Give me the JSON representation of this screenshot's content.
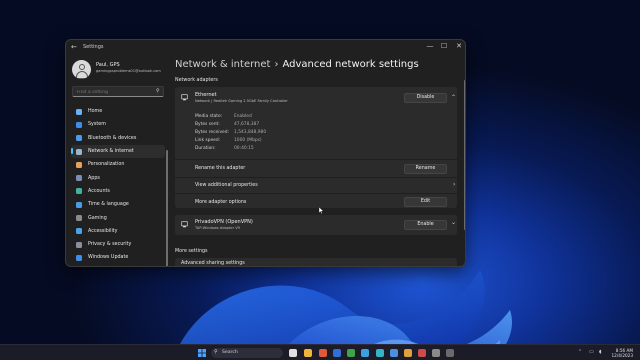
{
  "window": {
    "app_title": "Settings",
    "back_glyph": "←",
    "controls": {
      "minimize": "—",
      "maximize": "☐",
      "close": "✕"
    }
  },
  "user": {
    "name": "Paul, GPS",
    "email": "gamingpsproblems01@outlook.com"
  },
  "search": {
    "placeholder": "Find a setting",
    "icon": "search-icon"
  },
  "sidebar": {
    "items": [
      {
        "label": "Home",
        "color": "#6ab0f5"
      },
      {
        "label": "System",
        "color": "#3d8ee8"
      },
      {
        "label": "Bluetooth & devices",
        "color": "#4a9be8"
      },
      {
        "label": "Network & internet",
        "color": "#9fb3c8",
        "active": true
      },
      {
        "label": "Personalization",
        "color": "#e8a15b"
      },
      {
        "label": "Apps",
        "color": "#7c8db3"
      },
      {
        "label": "Accounts",
        "color": "#3fb3a0"
      },
      {
        "label": "Time & language",
        "color": "#4a9be8"
      },
      {
        "label": "Gaming",
        "color": "#8a8a8a"
      },
      {
        "label": "Accessibility",
        "color": "#4aa3e8"
      },
      {
        "label": "Privacy & security",
        "color": "#8a8fa0"
      },
      {
        "label": "Windows Update",
        "color": "#3d8ee8"
      }
    ]
  },
  "breadcrumb": {
    "parent": "Network & internet",
    "separator": "›",
    "current": "Advanced network settings"
  },
  "sections": {
    "adapters_label": "Network adapters",
    "more_label": "More settings"
  },
  "ethernet": {
    "name": "Ethernet",
    "description": "Network | Realtek Gaming 2.5GbE Family Controller",
    "button": "Disable",
    "details": [
      {
        "key": "Media state:",
        "value": "Enabled"
      },
      {
        "key": "Bytes sent:",
        "value": "47,678,387"
      },
      {
        "key": "Bytes received:",
        "value": "1,543,848,980"
      },
      {
        "key": "Link speed:",
        "value": "1000 (Mbps)"
      },
      {
        "key": "Duration:",
        "value": "00:40:15"
      }
    ],
    "rename_label": "Rename this adapter",
    "rename_button": "Rename",
    "view_props_label": "View additional properties",
    "more_options_label": "More adapter options",
    "edit_button": "Edit"
  },
  "vpn": {
    "name": "PrivadoVPN (OpenVPN)",
    "description": "TAP-Windows Adapter V9",
    "button": "Enable"
  },
  "advanced_sharing": {
    "label": "Advanced sharing settings"
  },
  "taskbar": {
    "search_label": "Search",
    "time": "8:56 AM",
    "date": "12/4/2023",
    "icon_colors": [
      "#4aa3ff",
      "#e0e0e0",
      "#f0b43c",
      "#3a7fe0",
      "#3fa34d",
      "#e05a3a",
      "#2f6fd6",
      "#3aa0e0",
      "#e0a13c",
      "#36b3c8",
      "#d04a4a",
      "#4a8fe0",
      "#8a8a8a",
      "#6a6a6a"
    ]
  }
}
